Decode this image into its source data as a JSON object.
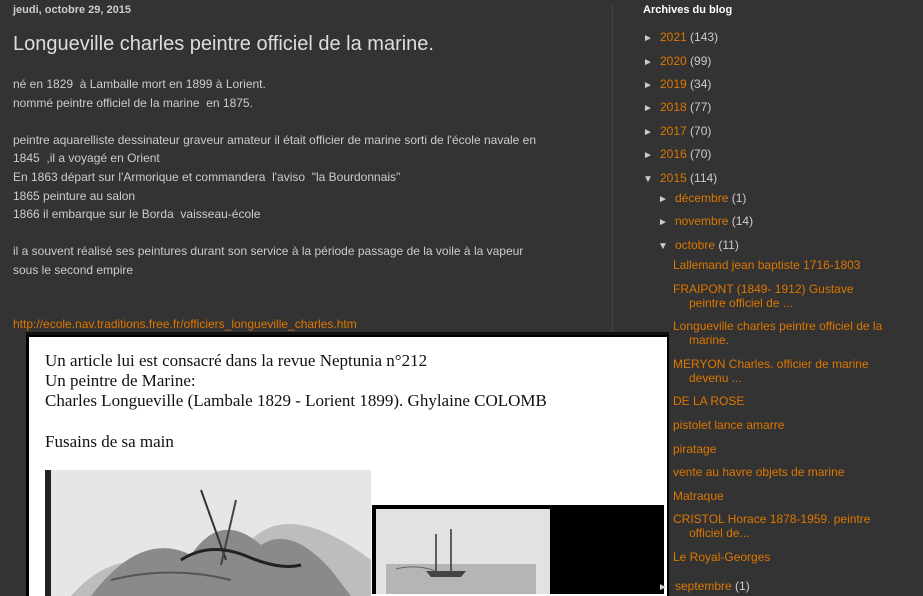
{
  "post": {
    "date": "jeudi, octobre 29, 2015",
    "title": "Longueville charles peintre officiel de la marine.",
    "body_lines": [
      "né en 1829  à Lamballe mort en 1899 à Lorient.",
      "nommé peintre officiel de la marine  en 1875.",
      "",
      "peintre aquarelliste dessinateur graveur amateur il était officier de marine sorti de l'école navale en",
      "1845  ,il a voyagé en Orient",
      "En 1863 départ sur l'Armorique et commandera  l'aviso  \"la Bourdonnais\"",
      "1865 peinture au salon",
      "1866 il embarque sur le Borda  vaisseau-école",
      "",
      "il a souvent réalisé ses peintures durant son service à la période passage de la voile à la vapeur",
      "sous le second empire"
    ],
    "link": "http://ecole.nav.traditions.free.fr/officiers_longueville_charles.htm",
    "image_text": [
      "Un article lui est consacré dans la revue Neptunia n°212",
      "Un peintre de Marine:",
      "Charles Longueville (Lambale 1829 - Lorient 1899). Ghylaine COLOMB",
      "Fusains de sa main"
    ]
  },
  "sidebar": {
    "title": "Archives du blog",
    "years": [
      {
        "toggle": "►",
        "year": "2021",
        "count": "(143)"
      },
      {
        "toggle": "►",
        "year": "2020",
        "count": "(99)"
      },
      {
        "toggle": "►",
        "year": "2019",
        "count": "(34)"
      },
      {
        "toggle": "►",
        "year": "2018",
        "count": "(77)"
      },
      {
        "toggle": "►",
        "year": "2017",
        "count": "(70)"
      },
      {
        "toggle": "►",
        "year": "2016",
        "count": "(70)"
      },
      {
        "toggle": "▼",
        "year": "2015",
        "count": "(114)"
      }
    ],
    "months": [
      {
        "toggle": "►",
        "month": "décembre",
        "count": "(1)"
      },
      {
        "toggle": "►",
        "month": "novembre",
        "count": "(14)"
      },
      {
        "toggle": "▼",
        "month": "octobre",
        "count": "(11)"
      }
    ],
    "posts": [
      {
        "l1": "Lallemand jean baptiste 1716-1803",
        "l2": ""
      },
      {
        "l1": "FRAIPONT (1849- 1912) Gustave",
        "l2": "peintre officiel de ..."
      },
      {
        "l1": "Longueville charles peintre officiel de la",
        "l2": "marine."
      },
      {
        "l1": "MERYON Charles. officier de marine",
        "l2": "devenu ..."
      },
      {
        "l1": "DE LA ROSE",
        "l2": ""
      },
      {
        "l1": "pistolet lance amarre",
        "l2": ""
      },
      {
        "l1": "piratage",
        "l2": ""
      },
      {
        "l1": "vente au havre objets de marine",
        "l2": ""
      },
      {
        "l1": "Matraque",
        "l2": ""
      },
      {
        "l1": "CRISTOL Horace 1878-1959. peintre",
        "l2": "officiel de..."
      },
      {
        "l1": "Le Royal-Georges",
        "l2": ""
      }
    ],
    "next_month": {
      "toggle": "►",
      "month": "septembre",
      "count": "(1)"
    }
  }
}
